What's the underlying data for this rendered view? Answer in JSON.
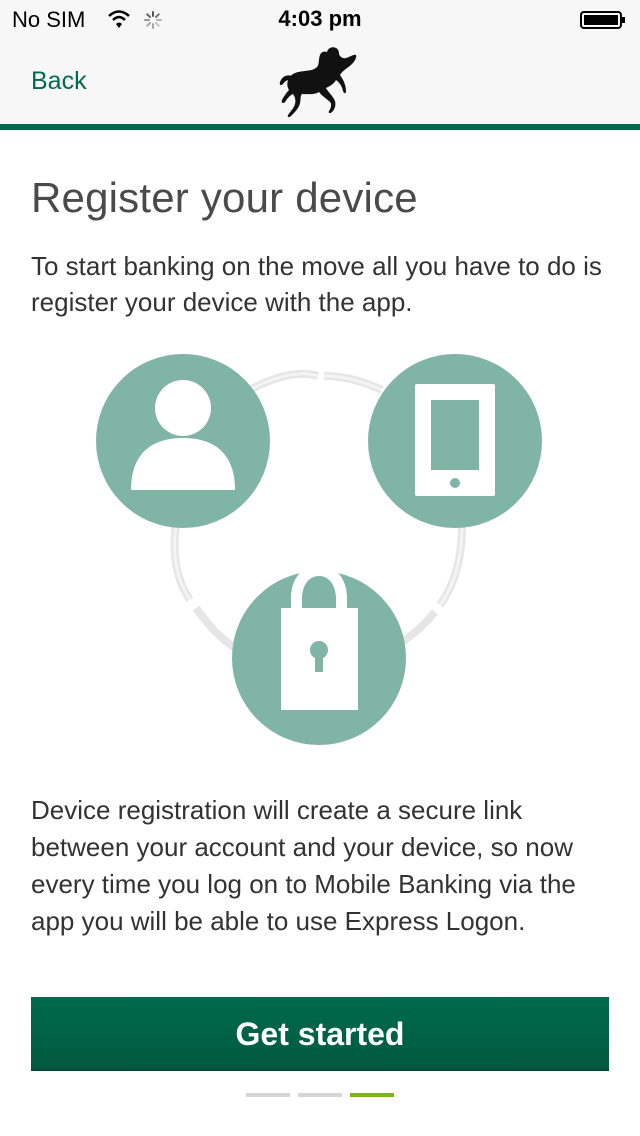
{
  "status_bar": {
    "carrier": "No SIM",
    "time": "4:03 pm",
    "icons": [
      "wifi-icon",
      "activity-spinner-icon",
      "battery-icon"
    ]
  },
  "nav_bar": {
    "back_label": "Back",
    "logo": "black-horse-logo"
  },
  "content": {
    "title": "Register your device",
    "intro": "To start banking on the move all you have to do is register your device with the app.",
    "illustration_icons": [
      "person-icon",
      "mobile-device-icon",
      "padlock-icon"
    ],
    "description": "Device registration will create a secure link between your account and your device, so now every time you log on to Mobile Banking via the app you will be able to use Express Logon.",
    "cta_label": "Get started"
  },
  "pagination": {
    "total_pages": 3,
    "current_page": 3
  },
  "colors": {
    "brand_green": "#006a4d",
    "illustration_teal": "#80b5a5",
    "active_indicator": "#7ab51d",
    "inactive_indicator": "#d6d6d6"
  }
}
